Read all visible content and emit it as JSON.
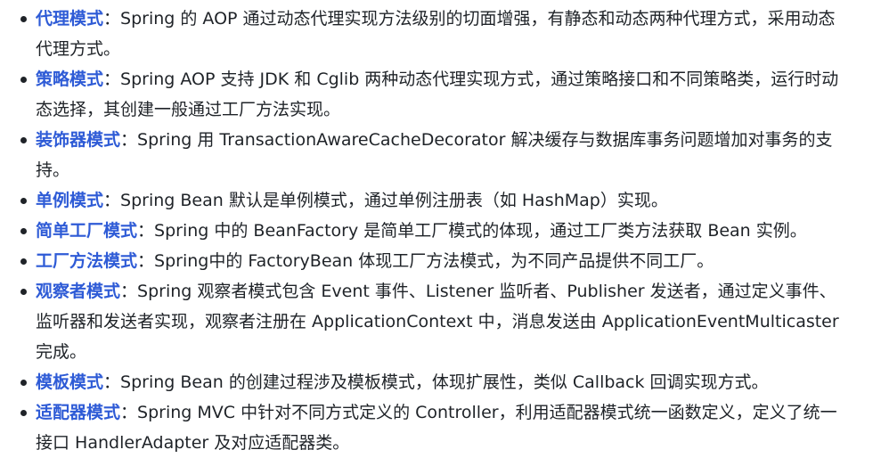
{
  "items": [
    {
      "name": "代理模式",
      "sep": "：",
      "desc": "Spring 的 AOP 通过动态代理实现方法级别的切面增强，有静态和动态两种代理方式，采用动态代理方式。"
    },
    {
      "name": "策略模式",
      "sep": "：",
      "desc": "Spring AOP 支持 JDK 和 Cglib 两种动态代理实现方式，通过策略接口和不同策略类，运行时动态选择，其创建一般通过工厂方法实现。"
    },
    {
      "name": "装饰器模式",
      "sep": "：",
      "desc": "Spring 用 TransactionAwareCacheDecorator 解决缓存与数据库事务问题增加对事务的支持。"
    },
    {
      "name": "单例模式",
      "sep": "：",
      "desc": "Spring Bean 默认是单例模式，通过单例注册表（如 HashMap）实现。"
    },
    {
      "name": "简单工厂模式",
      "sep": "：",
      "desc": "Spring 中的 BeanFactory 是简单工厂模式的体现，通过工厂类方法获取 Bean 实例。"
    },
    {
      "name": "工厂方法模式",
      "sep": "：",
      "desc": "Spring中的 FactoryBean 体现工厂方法模式，为不同产品提供不同工厂。"
    },
    {
      "name": "观察者模式",
      "sep": "：",
      "desc": "Spring 观察者模式包含 Event 事件、Listener 监听者、Publisher 发送者，通过定义事件、监听器和发送者实现，观察者注册在 ApplicationContext 中，消息发送由 ApplicationEventMulticaster 完成。"
    },
    {
      "name": "模板模式",
      "sep": "：",
      "desc": "Spring Bean 的创建过程涉及模板模式，体现扩展性，类似 Callback 回调实现方式。"
    },
    {
      "name": "适配器模式",
      "sep": "：",
      "desc": "Spring MVC 中针对不同方式定义的 Controller，利用适配器模式统一函数定义，定义了统一接口 HandlerAdapter 及对应适配器类。"
    }
  ]
}
